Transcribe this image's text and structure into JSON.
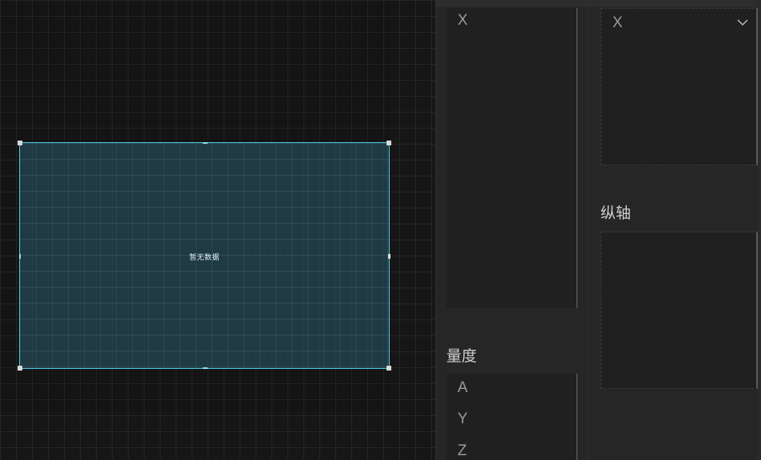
{
  "canvas": {
    "widget": {
      "empty_text": "暂无数据"
    }
  },
  "dimension_panel": {
    "items": [
      "X"
    ]
  },
  "measure_panel": {
    "label": "量度",
    "items": [
      "A",
      "Y",
      "Z"
    ]
  },
  "axis_panel": {
    "x_axis": {
      "selected": "X",
      "icon": "chevron-down-icon"
    },
    "y_axis": {
      "label": "纵轴"
    }
  },
  "colors": {
    "accent": "#4fc3d9",
    "panel_bg": "#262626",
    "canvas_bg": "#161616"
  }
}
